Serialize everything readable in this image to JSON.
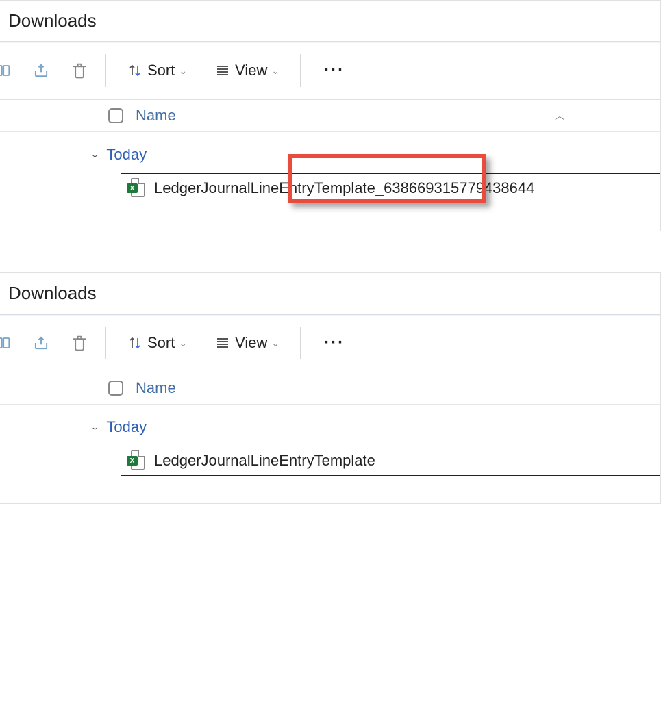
{
  "windows": [
    {
      "title": "Downloads",
      "toolbar": {
        "sort_label": "Sort",
        "view_label": "View"
      },
      "column_header": "Name",
      "group_label": "Today",
      "file_name": "LedgerJournalLineEntryTemplate_638669315779438644",
      "highlight": true
    },
    {
      "title": "Downloads",
      "toolbar": {
        "sort_label": "Sort",
        "view_label": "View"
      },
      "column_header": "Name",
      "group_label": "Today",
      "file_name": "LedgerJournalLineEntryTemplate",
      "highlight": false
    }
  ]
}
